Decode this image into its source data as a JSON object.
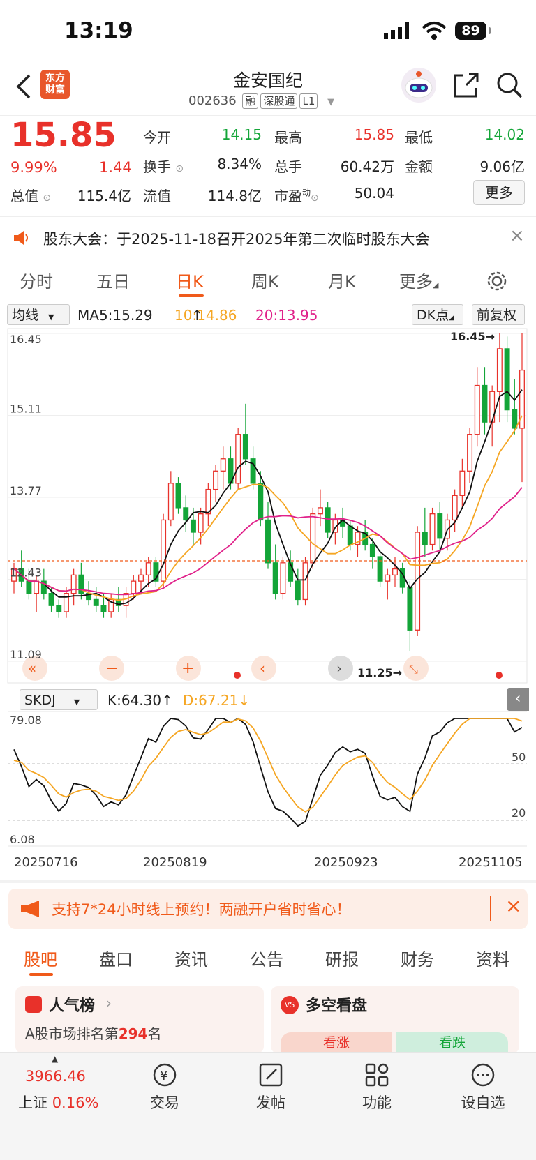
{
  "status": {
    "time": "13:19",
    "battery": "89"
  },
  "header": {
    "stock_name": "金安国纪",
    "code": "002636",
    "tags": [
      "融",
      "深股通",
      "L1"
    ],
    "logo_line1": "东方",
    "logo_line2": "财富"
  },
  "quote": {
    "price": "15.85",
    "change_pct": "9.99%",
    "change": "1.44",
    "open_label": "今开",
    "open": "14.15",
    "high_label": "最高",
    "high": "15.85",
    "low_label": "最低",
    "low": "14.02",
    "turnover_label": "换手",
    "turnover": "8.34%",
    "volume_label": "总手",
    "volume": "60.42万",
    "amount_label": "金额",
    "amount": "9.06亿",
    "mcap_label": "总值",
    "mcap": "115.4亿",
    "float_label": "流值",
    "float": "114.8亿",
    "pe_label": "市盈",
    "pe_sup": "动",
    "pe": "50.04",
    "more": "更多"
  },
  "notice": {
    "text": "股东大会：于2025-11-18召开2025年第二次临时股东大会"
  },
  "chart_tabs": [
    "分时",
    "五日",
    "日K",
    "周K",
    "月K",
    "更多"
  ],
  "chart_tab_active": "日K",
  "indicator": {
    "select": "均线",
    "ma5": "MA5:15.29",
    "ma10": "10:14.86",
    "ma20": "20:13.95",
    "dk": "DK点",
    "adjust": "前复权"
  },
  "kdj": {
    "select": "SKDJ",
    "k": "K:64.30",
    "d": "D:67.21"
  },
  "chart_data": {
    "type": "candlestick",
    "price_axis": {
      "ticks": [
        "16.45",
        "15.11",
        "13.77",
        "12.43",
        "11.09"
      ],
      "min": 11.09,
      "max": 16.45
    },
    "x_ticks": [
      "20250716",
      "20250819",
      "20250923",
      "20251105"
    ],
    "annotations": {
      "high": "16.45→",
      "low": "11.25→"
    },
    "candles": [
      [
        12.4,
        12.7,
        12.2,
        12.6
      ],
      [
        12.6,
        12.9,
        12.3,
        12.4
      ],
      [
        12.4,
        12.6,
        12.1,
        12.2
      ],
      [
        12.2,
        12.5,
        11.9,
        12.4
      ],
      [
        12.4,
        12.6,
        12.1,
        12.2
      ],
      [
        12.2,
        12.3,
        11.9,
        12.0
      ],
      [
        12.0,
        12.1,
        11.8,
        11.9
      ],
      [
        11.9,
        12.3,
        11.8,
        12.2
      ],
      [
        12.2,
        12.6,
        12.0,
        12.5
      ],
      [
        12.5,
        12.7,
        12.1,
        12.2
      ],
      [
        12.2,
        12.4,
        12.0,
        12.1
      ],
      [
        12.1,
        12.3,
        11.9,
        12.0
      ],
      [
        12.0,
        12.2,
        11.8,
        11.9
      ],
      [
        11.9,
        12.2,
        11.8,
        12.1
      ],
      [
        12.1,
        12.3,
        11.9,
        12.0
      ],
      [
        12.0,
        12.3,
        11.8,
        12.2
      ],
      [
        12.2,
        12.5,
        12.1,
        12.4
      ],
      [
        12.4,
        12.6,
        12.2,
        12.5
      ],
      [
        12.5,
        12.8,
        12.3,
        12.7
      ],
      [
        12.7,
        12.8,
        12.3,
        12.4
      ],
      [
        12.4,
        13.5,
        12.3,
        13.4
      ],
      [
        13.4,
        14.2,
        13.3,
        14.0
      ],
      [
        14.0,
        14.1,
        13.5,
        13.6
      ],
      [
        13.6,
        13.8,
        13.2,
        13.4
      ],
      [
        13.4,
        13.6,
        13.0,
        13.2
      ],
      [
        13.2,
        13.6,
        13.0,
        13.5
      ],
      [
        13.5,
        14.0,
        13.3,
        13.9
      ],
      [
        13.9,
        14.3,
        13.7,
        14.2
      ],
      [
        14.2,
        14.6,
        13.9,
        14.4
      ],
      [
        14.4,
        14.6,
        13.9,
        14.0
      ],
      [
        14.0,
        14.9,
        13.9,
        14.8
      ],
      [
        14.8,
        15.3,
        14.3,
        14.4
      ],
      [
        14.4,
        14.6,
        13.9,
        14.0
      ],
      [
        14.0,
        14.2,
        13.3,
        13.4
      ],
      [
        13.4,
        13.7,
        12.6,
        12.7
      ],
      [
        12.7,
        13.0,
        12.1,
        12.2
      ],
      [
        12.2,
        12.8,
        12.1,
        12.7
      ],
      [
        12.7,
        12.9,
        12.3,
        12.4
      ],
      [
        12.4,
        12.6,
        12.0,
        12.1
      ],
      [
        12.1,
        12.8,
        12.0,
        12.7
      ],
      [
        12.7,
        13.6,
        12.6,
        13.5
      ],
      [
        13.5,
        13.9,
        13.3,
        13.6
      ],
      [
        13.6,
        13.7,
        13.1,
        13.2
      ],
      [
        13.2,
        13.5,
        13.0,
        13.4
      ],
      [
        13.4,
        13.6,
        13.1,
        13.3
      ],
      [
        13.3,
        13.4,
        12.9,
        13.0
      ],
      [
        13.0,
        13.3,
        12.8,
        13.2
      ],
      [
        13.2,
        13.4,
        12.9,
        13.0
      ],
      [
        13.0,
        13.1,
        12.6,
        12.8
      ],
      [
        12.8,
        12.9,
        12.3,
        12.4
      ],
      [
        12.4,
        12.6,
        12.1,
        12.5
      ],
      [
        12.5,
        12.8,
        12.3,
        12.6
      ],
      [
        12.6,
        12.7,
        12.2,
        12.3
      ],
      [
        12.3,
        12.4,
        11.25,
        11.6
      ],
      [
        11.6,
        13.3,
        11.5,
        13.2
      ],
      [
        13.2,
        13.6,
        12.8,
        13.0
      ],
      [
        13.0,
        13.6,
        12.9,
        13.5
      ],
      [
        13.5,
        13.7,
        12.9,
        13.1
      ],
      [
        13.1,
        13.5,
        12.9,
        13.4
      ],
      [
        13.4,
        13.9,
        13.2,
        13.8
      ],
      [
        13.8,
        14.4,
        13.6,
        14.2
      ],
      [
        14.2,
        14.9,
        14.0,
        14.8
      ],
      [
        14.8,
        15.9,
        14.6,
        15.6
      ],
      [
        15.6,
        15.9,
        14.8,
        15.0
      ],
      [
        15.0,
        15.6,
        14.6,
        15.5
      ],
      [
        15.5,
        16.45,
        15.0,
        16.2
      ],
      [
        16.2,
        16.4,
        15.0,
        15.2
      ],
      [
        15.2,
        15.7,
        14.8,
        14.9
      ],
      [
        14.9,
        16.45,
        14.02,
        15.85
      ]
    ],
    "ma5": {
      "label": "MA5",
      "value": 15.29
    },
    "ma10": {
      "label": "10",
      "value": 14.86
    },
    "ma20": {
      "label": "20",
      "value": 13.95
    },
    "kdj_axis": {
      "ticks": [
        "79.08",
        "6.08"
      ],
      "levels": [
        "50",
        "20"
      ]
    }
  },
  "promo": {
    "text": "支持7*24小时线上预约！两融开户省时省心！"
  },
  "bottom_tabs": [
    "股吧",
    "盘口",
    "资讯",
    "公告",
    "研报",
    "财务",
    "资料"
  ],
  "cards": {
    "popular_title": "人气榜",
    "popular_sub_pre": "A股市场排名第",
    "popular_rank": "294",
    "popular_sub_post": "名",
    "bull_title": "多空看盘",
    "bull_up": "看涨",
    "bull_down": "看跌"
  },
  "nav": {
    "index_value": "3966.46",
    "index_name": "上证",
    "index_change": "0.16%",
    "trade": "交易",
    "post": "发帖",
    "func": "功能",
    "watch": "设自选"
  },
  "colors": {
    "up": "#e8312a",
    "down": "#13a538",
    "accent": "#f05a1a",
    "ma10": "#f5a623",
    "ma20": "#e0218a"
  }
}
